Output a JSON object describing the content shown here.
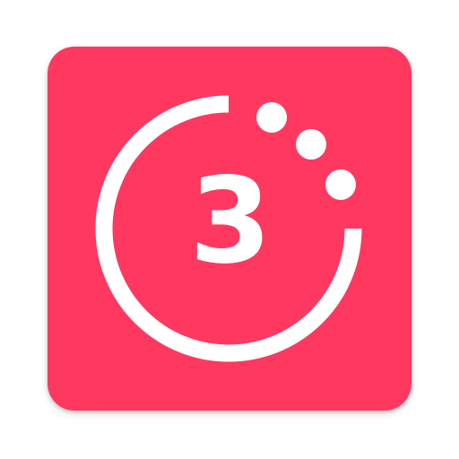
{
  "app_icon": {
    "background_color": "#FF3860",
    "foreground_color": "#FFFFFF",
    "countdown_number": "3",
    "icon": "countdown-timer-icon"
  }
}
